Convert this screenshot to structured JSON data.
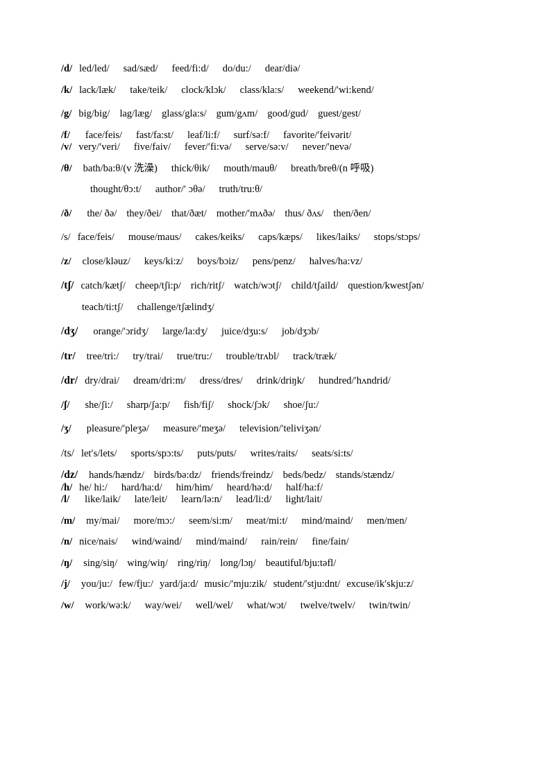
{
  "document": {
    "type": "phonetics-word-list",
    "language": "English with Chinese glosses",
    "rows": [
      {
        "id": "d",
        "symbol": "/d/",
        "symbol_style": "bold",
        "indent": "normal",
        "gap": "none",
        "words": [
          "led/led/",
          "sad/sæd/",
          "feed/fi:d/",
          "do/du:/",
          "dear/diə/"
        ]
      },
      {
        "id": "k",
        "symbol": "/k/",
        "symbol_style": "bold",
        "indent": "normal",
        "gap": "md",
        "words": [
          "lack/læk/",
          "take/teik/",
          "clock/klɔk/",
          "class/kla:s/",
          "weekend/′wi:kend/"
        ]
      },
      {
        "id": "g",
        "symbol": "/g/",
        "symbol_style": "bold",
        "indent": "normal",
        "gap": "lg",
        "words": [
          "big/big/",
          "lag/læg/",
          "glass/gla:s/",
          "gum/gʌm/",
          "good/gud/",
          "guest/gest/"
        ]
      },
      {
        "id": "f",
        "symbol": "/f/",
        "symbol_style": "bold",
        "indent": "normal",
        "gap": "md",
        "words": [
          "face/feis/",
          "fast/fa:st/",
          "leaf/li:f/",
          "surf/sə:f/",
          "favorite/′feivərit/"
        ]
      },
      {
        "id": "v",
        "symbol": "/v/",
        "symbol_style": "bold",
        "indent": "normal",
        "gap": "sm",
        "words": [
          "very/′veri/",
          "five/faiv/",
          "fever/′fi:və/",
          "serve/sə:v/",
          "never/′nevə/"
        ]
      },
      {
        "id": "theta",
        "symbol": "/θ/",
        "symbol_style": "bold",
        "indent": "normal",
        "gap": "md",
        "words": [
          "bath/ba:θ/(v 洗澡)",
          "thick/θik/",
          "mouth/mauθ/",
          "breath/breθ/(n 呼吸)"
        ]
      },
      {
        "id": "theta-cont",
        "symbol": "",
        "symbol_style": "none",
        "indent": "deep",
        "gap": "md",
        "words": [
          "thought/θɔ:t/",
          "author/′ ɔθə/",
          "truth/tru:θ/"
        ]
      },
      {
        "id": "eth",
        "symbol": "/ð/",
        "symbol_style": "bold",
        "indent": "normal",
        "gap": "lg",
        "words": [
          "the/ ðə/",
          "they/ðei/",
          "that/ðæt/",
          "mother/′mʌðə/",
          "thus/ ðʌs/",
          "then/ðen/"
        ]
      },
      {
        "id": "s",
        "symbol": "/s/",
        "symbol_style": "plain",
        "indent": "normal",
        "gap": "lg",
        "words": [
          "face/feis/",
          "mouse/maus/",
          "cakes/keiks/",
          "caps/kæps/",
          "likes/laiks/",
          "stops/stɔps/"
        ]
      },
      {
        "id": "z",
        "symbol": "/z/",
        "symbol_style": "bold",
        "indent": "normal",
        "gap": "lg",
        "words": [
          "close/kləuz/",
          "keys/ki:z/",
          "boys/bɔiz/",
          "pens/penz/",
          "halves/ha:vz/"
        ]
      },
      {
        "id": "tsh",
        "symbol": "/tʃ/",
        "symbol_style": "bold",
        "indent": "normal",
        "gap": "lg",
        "words": [
          "catch/kætʃ/",
          "cheep/tʃi:p/",
          "rich/ritʃ/",
          "watch/wɔtʃ/",
          "child/tʃaild/",
          "question/kwestʃən/"
        ]
      },
      {
        "id": "tsh-cont",
        "symbol": "",
        "symbol_style": "none",
        "indent": "mid",
        "gap": "md",
        "words": [
          "teach/ti:tʃ/",
          "challenge/tʃælindʒ/"
        ]
      },
      {
        "id": "dzh",
        "symbol": "/dʒ/",
        "symbol_style": "bold",
        "indent": "normal",
        "gap": "lg",
        "words": [
          "orange/′ɔridʒ/",
          "large/la:dʒ/",
          "juice/dʒu:s/",
          "job/dʒɔb/"
        ]
      },
      {
        "id": "tr",
        "symbol": "/tr/",
        "symbol_style": "bold",
        "indent": "normal",
        "gap": "lg",
        "words": [
          "tree/tri:/",
          "try/trai/",
          "true/tru:/",
          "trouble/trʌbl/",
          "track/træk/"
        ]
      },
      {
        "id": "dr",
        "symbol": "/dr/",
        "symbol_style": "bold",
        "indent": "normal",
        "gap": "lg",
        "words": [
          "dry/drai/",
          "dream/dri:m/",
          "dress/dres/",
          "drink/driŋk/",
          "hundred/′hʌndrid/"
        ]
      },
      {
        "id": "sh",
        "symbol": "/ʃ/",
        "symbol_style": "bold",
        "indent": "normal",
        "gap": "lg",
        "words": [
          "she/ʃi:/",
          "sharp/ʃa:p/",
          "fish/fiʃ/",
          "shock/ʃɔk/",
          "shoe/ʃu:/"
        ]
      },
      {
        "id": "zh",
        "symbol": "/ʒ/",
        "symbol_style": "bold",
        "indent": "normal",
        "gap": "lg",
        "words": [
          "pleasure/′pleʒə/",
          "measure/′meʒə/",
          "television/′teliviʒən/"
        ]
      },
      {
        "id": "ts",
        "symbol": "/ts/",
        "symbol_style": "plain",
        "indent": "normal",
        "gap": "lg",
        "words": [
          "let′s/lets/",
          "sports/spɔ:ts/",
          "puts/puts/",
          "writes/raits/",
          "seats/si:ts/"
        ]
      },
      {
        "id": "dz",
        "symbol": "/dz/",
        "symbol_style": "bold",
        "indent": "normal",
        "gap": "md",
        "words": [
          "hands/hændz/",
          "birds/bə:dz/",
          "friends/freindz/",
          "beds/bedz/",
          "stands/stændz/"
        ]
      },
      {
        "id": "h",
        "symbol": "/h/",
        "symbol_style": "bold",
        "indent": "normal",
        "gap": "sm",
        "words": [
          "he/ hi:/",
          "hard/ha:d/",
          "him/him/",
          "heard/hə:d/",
          "half/ha:f/"
        ]
      },
      {
        "id": "l",
        "symbol": "/l/",
        "symbol_style": "bold",
        "indent": "normal",
        "gap": "sm",
        "words": [
          "like/laik/",
          "late/leit/",
          "learn/lə:n/",
          "lead/li:d/",
          "light/lait/"
        ]
      },
      {
        "id": "m",
        "symbol": "/m/",
        "symbol_style": "bold",
        "indent": "normal",
        "gap": "md",
        "words": [
          "my/mai/",
          "more/mɔ:/",
          "seem/si:m/",
          "meat/mi:t/",
          "mind/maind/",
          "men/men/"
        ]
      },
      {
        "id": "n",
        "symbol": "/n/",
        "symbol_style": "bold",
        "indent": "normal",
        "gap": "md",
        "words": [
          "nice/nais/",
          "wind/waind/",
          "mind/maind/",
          "rain/rein/",
          "fine/fain/"
        ]
      },
      {
        "id": "ng",
        "symbol": "/ŋ/",
        "symbol_style": "bold",
        "indent": "normal",
        "gap": "md",
        "words": [
          "sing/siŋ/",
          "wing/wiŋ/",
          "ring/riŋ/",
          "long/lɔŋ/",
          "beautiful/bju:təfl/"
        ]
      },
      {
        "id": "j",
        "symbol": "/j/",
        "symbol_style": "bold",
        "indent": "normal",
        "gap": "md",
        "words": [
          "you/ju:/",
          "few/fju:/",
          "yard/ja:d/",
          "music/′mju:zik/",
          "student/′stju:dnt/",
          "excuse/ik′skju:z/"
        ]
      },
      {
        "id": "w",
        "symbol": "/w/",
        "symbol_style": "bold",
        "indent": "normal",
        "gap": "md",
        "words": [
          "work/wə:k/",
          "way/wei/",
          "well/wel/",
          "what/wɔt/",
          "twelve/twelv/",
          "twin/twin/"
        ]
      }
    ]
  }
}
